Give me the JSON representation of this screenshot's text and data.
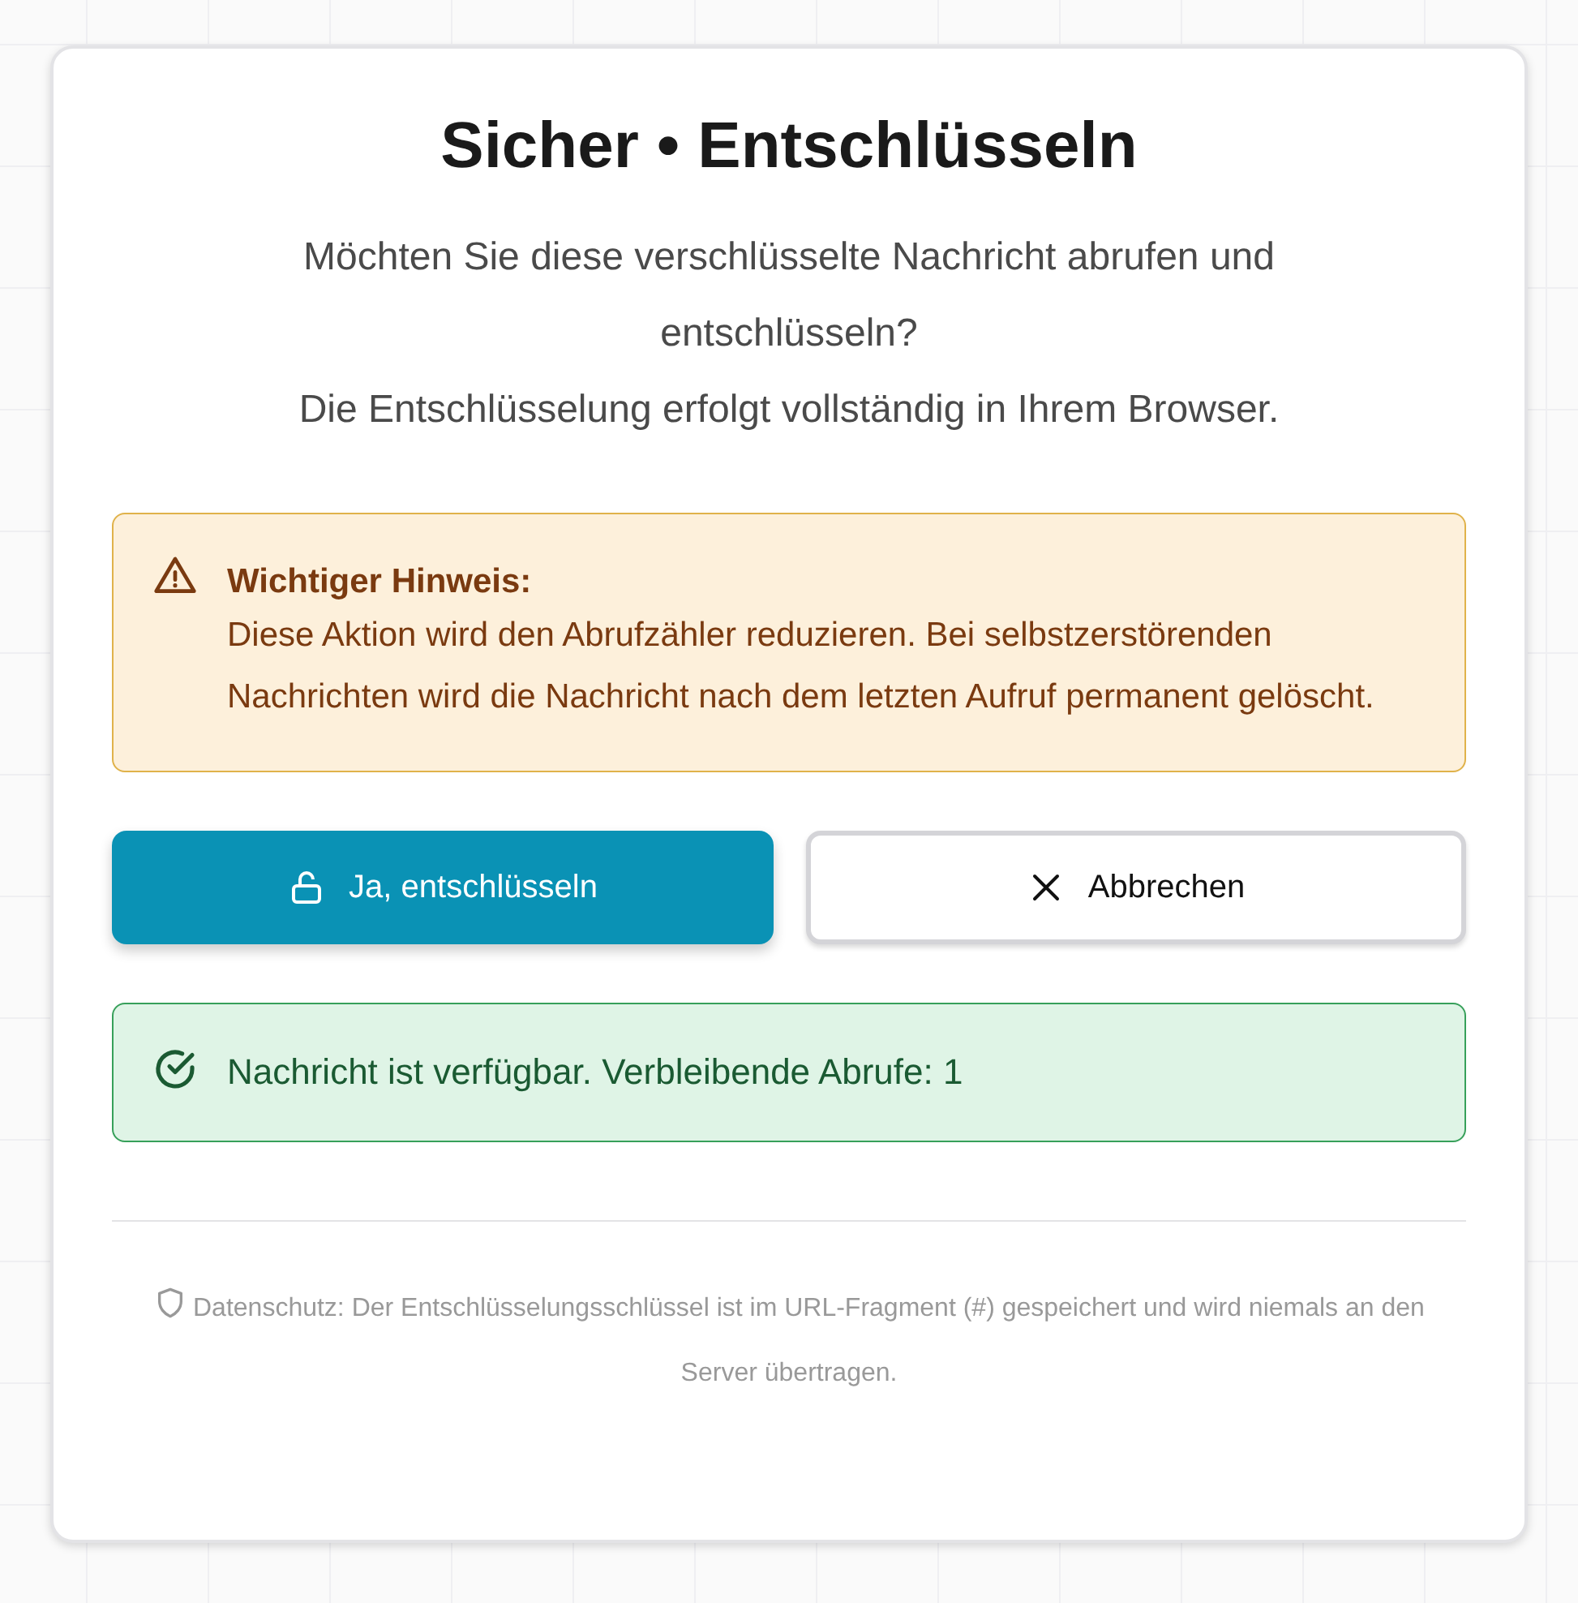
{
  "dialog": {
    "title": "Sicher • Entschlüsseln",
    "intro": [
      "Möchten Sie diese verschlüsselte Nachricht abrufen und entschlüsseln?",
      "Die Entschlüsselung erfolgt vollständig in Ihrem Browser."
    ],
    "warning": {
      "title": "Wichtiger Hinweis:",
      "text": "Diese Aktion wird den Abrufzähler reduzieren. Bei selbstzerstörenden Nachrichten wird die Nachricht nach dem letzten Aufruf permanent gelöscht."
    },
    "buttons": [
      {
        "kind": "primary",
        "label": "Ja, entschlüsseln"
      },
      {
        "kind": "secondary",
        "label": "Abbrechen"
      }
    ],
    "status": {
      "kind": "success",
      "text": "Nachricht ist verfügbar. Verbleibende Abrufe: 1"
    },
    "privacy_note": "Datenschutz: Der Entschlüsselungsschlüssel ist im URL-Fragment (#) gespeichert und wird niemals an den Server übertragen."
  }
}
